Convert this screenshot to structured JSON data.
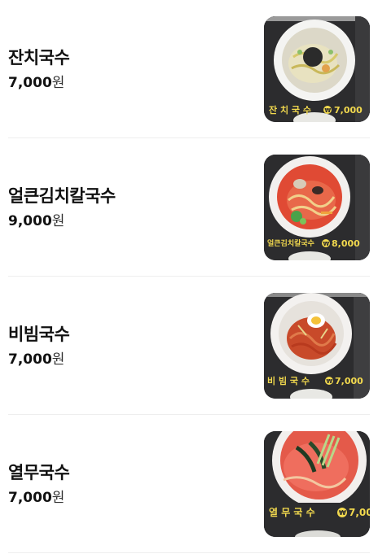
{
  "items": [
    {
      "name": "잔치국수",
      "price": "7,000",
      "unit": "원",
      "sign_name": "잔 치 국 수",
      "sign_price": "7,000"
    },
    {
      "name": "얼큰김치칼국수",
      "price": "9,000",
      "unit": "원",
      "sign_name": "얼큰김치칼국수",
      "sign_price": "8,000"
    },
    {
      "name": "비빔국수",
      "price": "7,000",
      "unit": "원",
      "sign_name": "비 빔 국 수",
      "sign_price": "7,000"
    },
    {
      "name": "열무국수",
      "price": "7,000",
      "unit": "원",
      "sign_name": "열 무 국 수",
      "sign_price": "7,00"
    }
  ],
  "won_symbol": "₩",
  "colors": {
    "sign_text": "#f2d94e",
    "sign_bg": "#2a2a2c",
    "divider": "#eeeeee"
  }
}
